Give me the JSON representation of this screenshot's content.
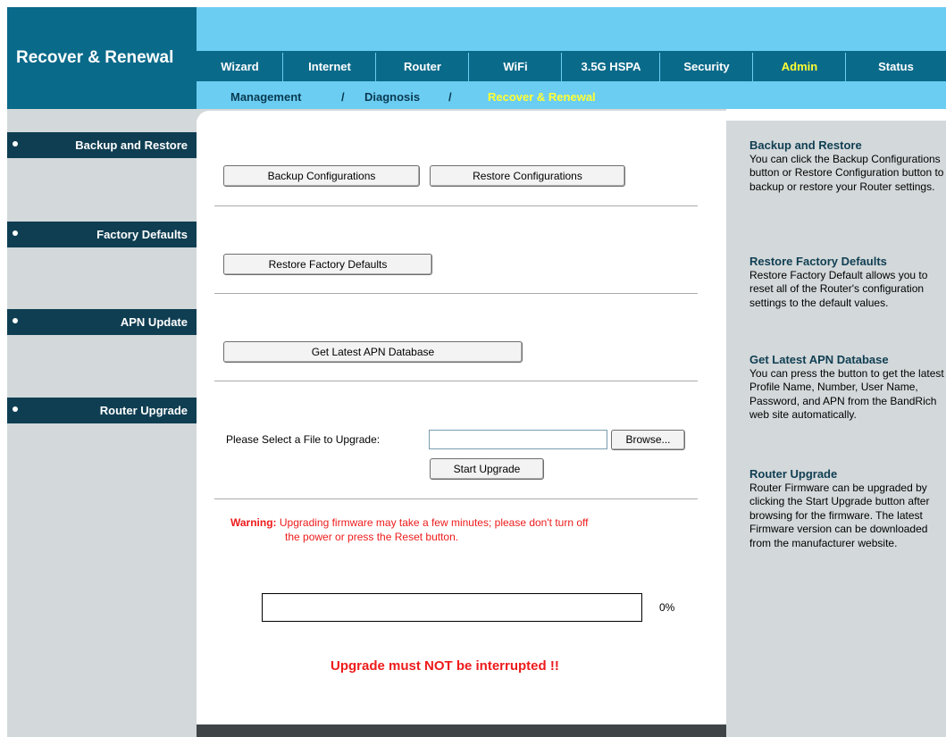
{
  "header": {
    "title": "Recover & Renewal",
    "tabs": [
      {
        "label": "Wizard",
        "active": false
      },
      {
        "label": "Internet",
        "active": false
      },
      {
        "label": "Router",
        "active": false
      },
      {
        "label": "WiFi",
        "active": false
      },
      {
        "label": "3.5G HSPA",
        "active": false
      },
      {
        "label": "Security",
        "active": false
      },
      {
        "label": "Admin",
        "active": true
      },
      {
        "label": "Status",
        "active": false
      }
    ],
    "subnav": [
      {
        "label": "Management",
        "active": false
      },
      {
        "label": "Diagnosis",
        "active": false
      },
      {
        "label": "Recover & Renewal",
        "active": true
      }
    ],
    "subnav_separator": "/"
  },
  "sidebar": {
    "items": [
      {
        "label": "Backup and Restore"
      },
      {
        "label": "Factory Defaults"
      },
      {
        "label": "APN Update"
      },
      {
        "label": "Router Upgrade"
      }
    ]
  },
  "main": {
    "backup_button": "Backup Configurations",
    "restore_button": "Restore Configurations",
    "factory_button": "Restore Factory Defaults",
    "apn_button": "Get Latest APN Database",
    "upgrade_label": "Please Select a File to Upgrade:",
    "file_value": "",
    "browse_button": "Browse...",
    "start_upgrade_button": "Start Upgrade",
    "warning_title": "Warning:",
    "warning_line1": " Upgrading firmware may take a few minutes; please don't turn off",
    "warning_line2": "the power or press the Reset button.",
    "progress_percent": 0,
    "progress_text": "0%",
    "interrupt_message": "Upgrade must NOT be interrupted !!"
  },
  "help": {
    "sections": [
      {
        "title": "Backup and Restore",
        "text": "You can click the Backup Configurations button or Restore Configuration button to backup or restore your Router settings."
      },
      {
        "title": "Restore Factory Defaults",
        "text": "Restore Factory Default allows you to reset all of the Router's configuration settings to the default values."
      },
      {
        "title": "Get Latest APN Database",
        "text": "You can press the button to get the latest Profile Name, Number, User Name, Password, and APN from the BandRich web site automatically."
      },
      {
        "title": "Router Upgrade",
        "text": "Router Firmware can be upgraded by clicking the Start Upgrade button after browsing for the firmware. The latest Firmware version can be downloaded from the manufacturer website."
      }
    ]
  },
  "colors": {
    "header_dark": "#0a6a8a",
    "header_light": "#6ccdf2",
    "sidebar_item": "#0f3e52",
    "active_tab": "#ffff33",
    "warning": "#ee1b1b"
  }
}
